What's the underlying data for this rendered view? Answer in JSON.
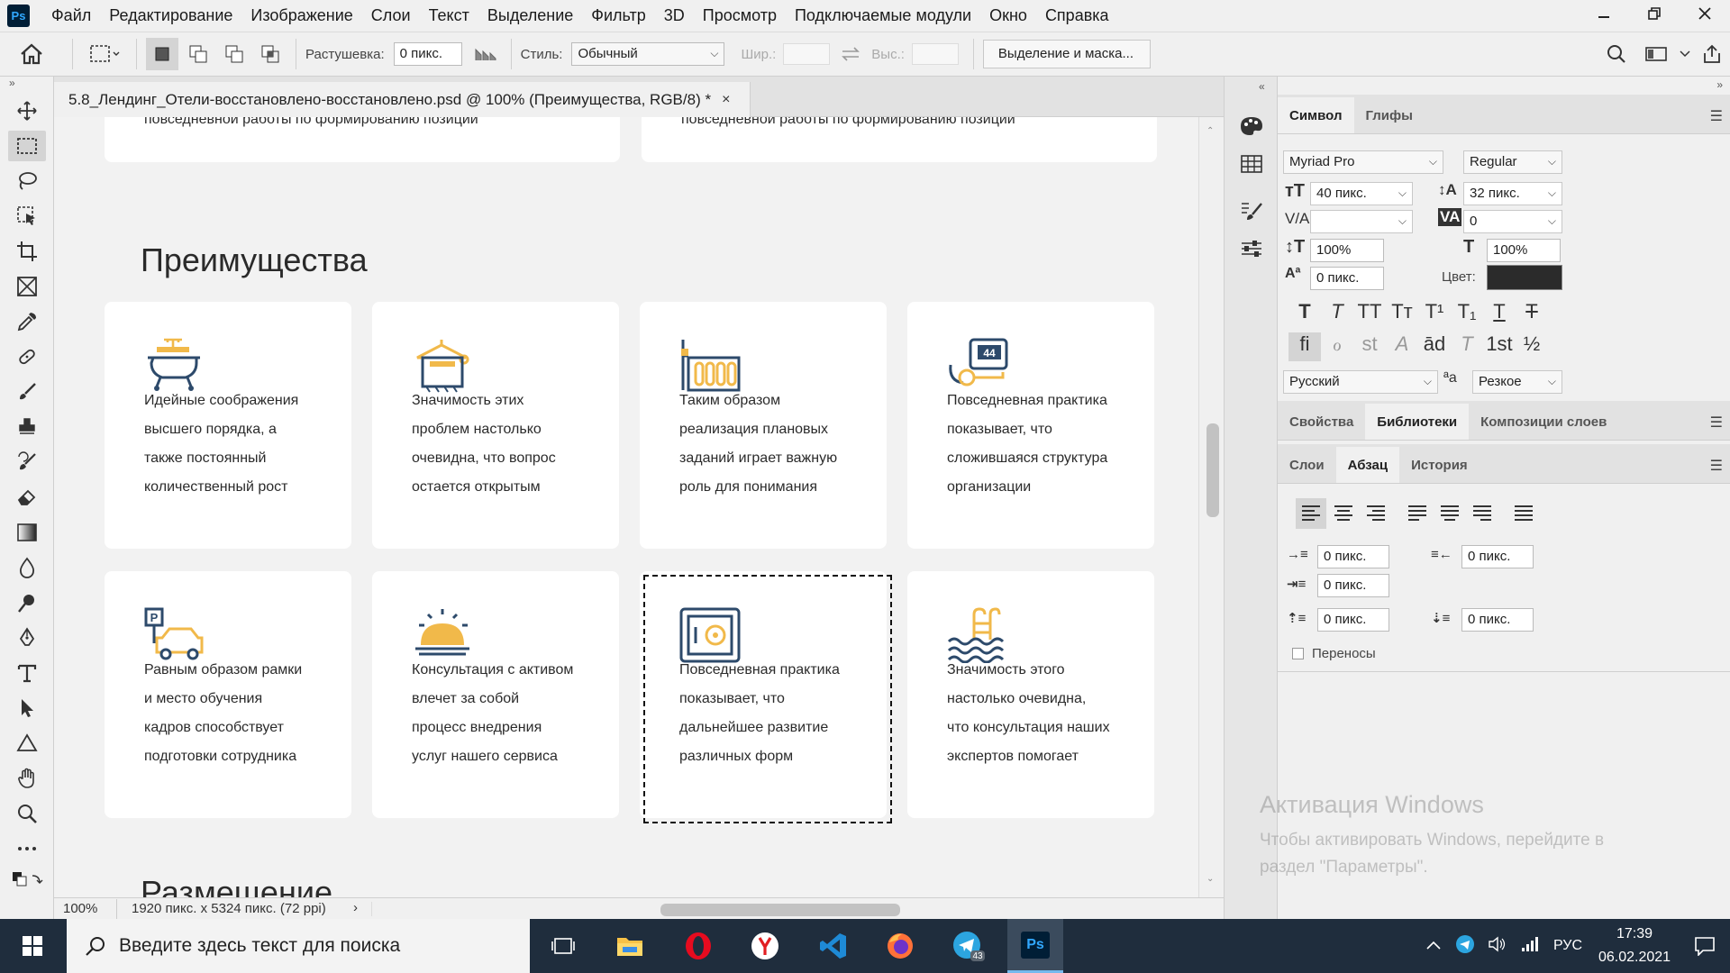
{
  "menubar": {
    "logo": "Ps",
    "items": [
      "Файл",
      "Редактирование",
      "Изображение",
      "Слои",
      "Текст",
      "Выделение",
      "Фильтр",
      "3D",
      "Просмотр",
      "Подключаемые модули",
      "Окно",
      "Справка"
    ]
  },
  "options": {
    "feather_label": "Растушевка:",
    "feather_value": "0 пикс.",
    "style_label": "Стиль:",
    "style_value": "Обычный",
    "width_label": "Шир.:",
    "height_label": "Выс.:",
    "select_mask_label": "Выделение и маска..."
  },
  "document": {
    "tab_title": "5.8_Лендинг_Отели-восстановлено-восстановлено.psd @ 100% (Преимущества, RGB/8) *",
    "close_glyph": "×",
    "top_cards": [
      "повседневной работы по формированию позиции",
      "повседневной работы по формированию позиции"
    ],
    "section_title": "Преимущества",
    "section_title_next": "Размещение",
    "cards": [
      {
        "icon": "bathtub-icon",
        "lines": [
          "Идейные соображения",
          "высшего порядка, а",
          "также постоянный",
          "количественный рост"
        ]
      },
      {
        "icon": "towel-hanger-icon",
        "lines": [
          "Значимость этих",
          "проблем настолько",
          "очевидна, что вопрос",
          "остается открытым"
        ]
      },
      {
        "icon": "radiator-icon",
        "lines": [
          "Таким образом",
          "реализация плановых",
          "заданий играет важную",
          "роль для понимания"
        ]
      },
      {
        "icon": "tv-icon",
        "lines": [
          "Повседневная практика",
          "показывает, что",
          "сложившаяся структура",
          "организации"
        ]
      },
      {
        "icon": "parking-icon",
        "lines": [
          "Равным образом рамки",
          "и место обучения",
          "кадров способствует",
          "подготовки сотрудника"
        ]
      },
      {
        "icon": "service-bell-icon",
        "lines": [
          "Консультация с активом",
          "влечет за собой",
          "процесс внедрения",
          "услуг нашего сервиса"
        ]
      },
      {
        "icon": "safe-icon",
        "lines": [
          "Повседневная практика",
          "показывает, что",
          "дальнейшее развитие",
          "различных форм"
        ]
      },
      {
        "icon": "pool-icon",
        "lines": [
          "Значимость этого",
          "настолько очевидна,",
          "что консультация наших",
          "экспертов помогает"
        ]
      }
    ]
  },
  "status": {
    "zoom": "100%",
    "info": "1920 пикс. x 5324 пикс. (72 ppi)",
    "arrow": "›"
  },
  "character_panel": {
    "tabs": [
      "Символ",
      "Глифы"
    ],
    "font_family": "Myriad Pro",
    "font_style": "Regular",
    "font_size": "40 пикс.",
    "leading": "32 пикс.",
    "kerning": "",
    "tracking": "0",
    "vscale": "100%",
    "hscale": "100%",
    "baseline": "0 пикс.",
    "color_label": "Цвет:",
    "color_value": "#2b2b2b",
    "language": "Русский",
    "aa_label": "ªa",
    "antialias": "Резкое",
    "style_glyphs": [
      "T",
      "T",
      "TT",
      "Tт",
      "T¹",
      "T₁",
      "T",
      "T"
    ],
    "ot_glyphs": [
      "fi",
      "ℴ",
      "st",
      "A",
      "ād",
      "T",
      "1st",
      "½"
    ]
  },
  "props_tabs": [
    "Свойства",
    "Библиотеки",
    "Композиции слоев"
  ],
  "paragraph_tabs": [
    "Слои",
    "Абзац",
    "История"
  ],
  "paragraph": {
    "indent_left": "0 пикс.",
    "indent_right": "0 пикс.",
    "indent_first": "0 пикс.",
    "space_before": "0 пикс.",
    "space_after": "0 пикс.",
    "hyphenation_label": "Переносы"
  },
  "watermark": {
    "title": "Активация Windows",
    "line1": "Чтобы активировать Windows, перейдите в",
    "line2": "раздел \"Параметры\"."
  },
  "taskbar": {
    "search_placeholder": "Введите здесь текст для поиска",
    "telegram_badge": "43",
    "ps_label": "Ps",
    "lang": "РУС",
    "time": "17:39",
    "date": "06.02.2021"
  },
  "colors": {
    "navy": "#2d4a6b",
    "accent_yellow": "#f1b94a"
  }
}
